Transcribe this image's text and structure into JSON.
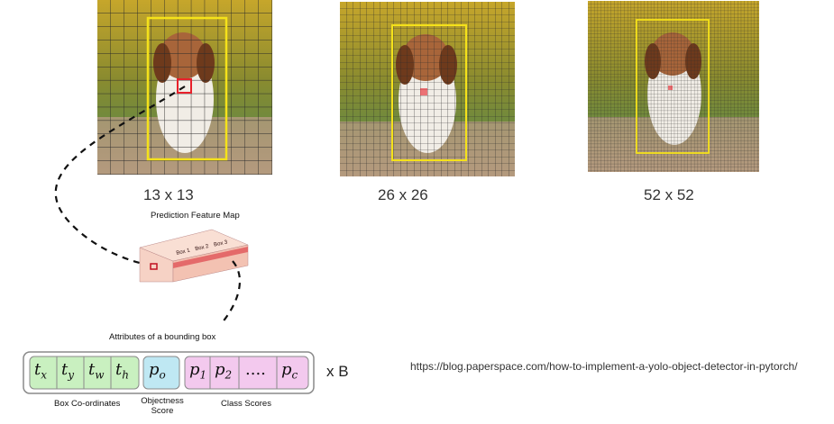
{
  "grids": [
    {
      "label": "13 x 13",
      "n": 13
    },
    {
      "label": "26 x 26",
      "n": 26
    },
    {
      "label": "52 x 52",
      "n": 52
    }
  ],
  "feature_map": {
    "title": "Prediction Feature Map",
    "cell_labels": [
      "Box 1",
      "Box 2",
      "Box 3"
    ]
  },
  "attributes_title": "Attributes of a bounding box",
  "vector": {
    "coords": [
      "t_x",
      "t_y",
      "t_w",
      "t_h"
    ],
    "objectness": "p_o",
    "classes": [
      "p_1",
      "p_2",
      "....",
      "p_c"
    ],
    "multiplier": "x B",
    "captions": {
      "coords": "Box Co-ordinates",
      "objectness_line1": "Objectness",
      "objectness_line2": "Score",
      "classes": "Class Scores"
    }
  },
  "source_url": "https://blog.paperspace.com/how-to-implement-a-yolo-object-detector-in-pytorch/",
  "colors": {
    "coords_fill": "#c9f0c0",
    "objectness_fill": "#bfe8f3",
    "classes_fill": "#f3c9ee",
    "bbox_yellow": "#f5e21a",
    "cell_red": "#e8202a",
    "box_face": "#f7cfc0"
  }
}
